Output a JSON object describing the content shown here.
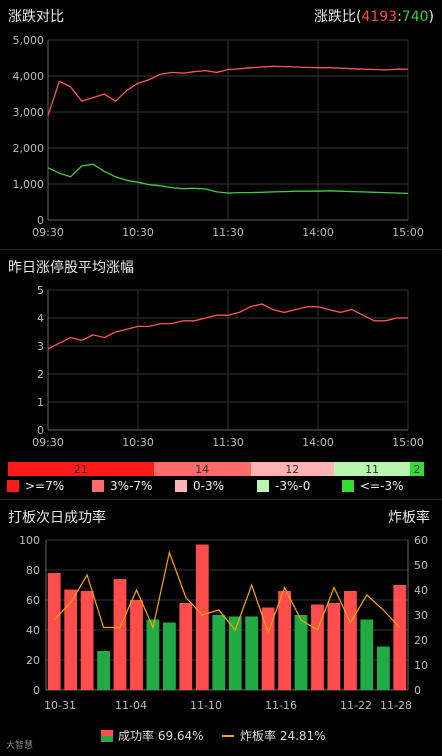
{
  "panel1": {
    "title": "涨跌对比",
    "ratio_label": "涨跌比(",
    "up_count": "4193",
    "colon": ":",
    "down_count": "740",
    "close_paren": ")"
  },
  "panel2": {
    "title": "昨日涨停股平均涨幅"
  },
  "panel3": {
    "title": "打板次日成功率",
    "right_title": "炸板率"
  },
  "distribution": [
    {
      "value": "21",
      "color": "#ff1a1a"
    },
    {
      "value": "14",
      "color": "#ff6b6b"
    },
    {
      "value": "12",
      "color": "#ffb3b3"
    },
    {
      "value": "11",
      "color": "#b9f5b0"
    },
    {
      "value": "2",
      "color": "#33dd33"
    }
  ],
  "dist_legend": [
    {
      "label": ">=7%",
      "color": "#ff1a1a"
    },
    {
      "label": "3%-7%",
      "color": "#ff6b6b"
    },
    {
      "label": "0-3%",
      "color": "#ffb3b3"
    },
    {
      "label": "-3%-0",
      "color": "#b9f5b0"
    },
    {
      "label": "<=-3%",
      "color": "#33dd33"
    }
  ],
  "bottom_legend": {
    "success_label": "成功率 69.64%",
    "blast_label": "炸板率 24.81%"
  },
  "watermark": "大智慧",
  "chart_data": [
    {
      "type": "line",
      "xlim": [
        "09:30",
        "15:00"
      ],
      "x_ticks": [
        "09:30",
        "10:30",
        "11:30",
        "14:00",
        "15:00"
      ],
      "y_ticks": [
        "0",
        "1,000",
        "2,000",
        "3,000",
        "4,000",
        "5,000"
      ],
      "ylim": [
        0,
        5000
      ],
      "grid": true,
      "series": [
        {
          "color": "#ff5555",
          "values": [
            2900,
            3850,
            3700,
            3300,
            3400,
            3500,
            3300,
            3600,
            3800,
            3900,
            4050,
            4100,
            4080,
            4120,
            4150,
            4100,
            4180,
            4200,
            4230,
            4250,
            4270,
            4260,
            4250,
            4240,
            4230,
            4230,
            4220,
            4200,
            4190,
            4180,
            4170,
            4190,
            4193
          ]
        },
        {
          "color": "#44cc44",
          "values": [
            1450,
            1300,
            1200,
            1500,
            1550,
            1350,
            1200,
            1100,
            1050,
            980,
            950,
            900,
            870,
            880,
            860,
            780,
            750,
            760,
            760,
            770,
            780,
            790,
            800,
            800,
            800,
            810,
            800,
            790,
            780,
            770,
            760,
            750,
            740
          ]
        }
      ]
    },
    {
      "type": "line",
      "xlim": [
        "09:30",
        "15:00"
      ],
      "x_ticks": [
        "09:30",
        "10:30",
        "11:30",
        "14:00",
        "15:00"
      ],
      "y_ticks": [
        "0",
        "1",
        "2",
        "3",
        "4",
        "5"
      ],
      "ylim": [
        0,
        5
      ],
      "grid": true,
      "series": [
        {
          "color": "#ff5555",
          "values": [
            2.9,
            3.1,
            3.3,
            3.2,
            3.4,
            3.3,
            3.5,
            3.6,
            3.7,
            3.7,
            3.8,
            3.8,
            3.9,
            3.9,
            4.0,
            4.1,
            4.1,
            4.2,
            4.4,
            4.5,
            4.3,
            4.2,
            4.3,
            4.4,
            4.4,
            4.3,
            4.2,
            4.3,
            4.1,
            3.9,
            3.9,
            4.0,
            4.0
          ]
        }
      ]
    },
    {
      "type": "bar",
      "categories": [
        "10-31",
        "11-01",
        "11-02",
        "11-03",
        "11-04",
        "11-05",
        "11-06",
        "11-07",
        "11-08",
        "11-09",
        "11-10",
        "11-11",
        "11-12",
        "11-13",
        "11-14",
        "11-15",
        "11-16",
        "11-17",
        "11-18",
        "11-19",
        "11-20",
        "11-21",
        "11-22",
        "11-23",
        "11-24",
        "11-25",
        "11-26",
        "11-27",
        "11-28"
      ],
      "x_tick_labels": [
        "10-31",
        "11-04",
        "11-10",
        "11-16",
        "11-22",
        "11-28"
      ],
      "x_tick_indices": [
        0,
        4,
        10,
        16,
        22,
        28
      ],
      "ylim_left": [
        0,
        100
      ],
      "ylim_right": [
        0,
        60
      ],
      "y_ticks_left": [
        "0",
        "20",
        "40",
        "60",
        "80",
        "100"
      ],
      "y_ticks_right": [
        "0",
        "10",
        "20",
        "30",
        "40",
        "50",
        "60"
      ],
      "series": [
        {
          "name": "成功率",
          "axis": "left",
          "values": [
            78,
            67,
            66,
            26,
            74,
            60,
            47,
            45,
            58,
            97,
            50,
            49,
            49,
            55,
            66,
            50,
            57,
            58,
            66,
            47,
            29,
            70
          ]
        },
        {
          "name": "炸板率",
          "axis": "right",
          "values": [
            28,
            35,
            46,
            25,
            25,
            40,
            25,
            55,
            37,
            30,
            32,
            24,
            42,
            23,
            41,
            28,
            24,
            41,
            27,
            38,
            32,
            25
          ]
        }
      ],
      "bar_colors": [
        "#ff4c4c",
        "#ff4c4c",
        "#ff4c4c",
        "#22aa44",
        "#ff4c4c",
        "#ff4c4c",
        "#22aa44",
        "#22aa44",
        "#ff4c4c",
        "#ff4c4c",
        "#22aa44",
        "#22aa44",
        "#22aa44",
        "#ff4c4c",
        "#ff4c4c",
        "#22aa44",
        "#ff4c4c",
        "#ff4c4c",
        "#ff4c4c",
        "#22aa44",
        "#22aa44",
        "#ff4c4c"
      ],
      "line_color": "#ffa500"
    }
  ]
}
